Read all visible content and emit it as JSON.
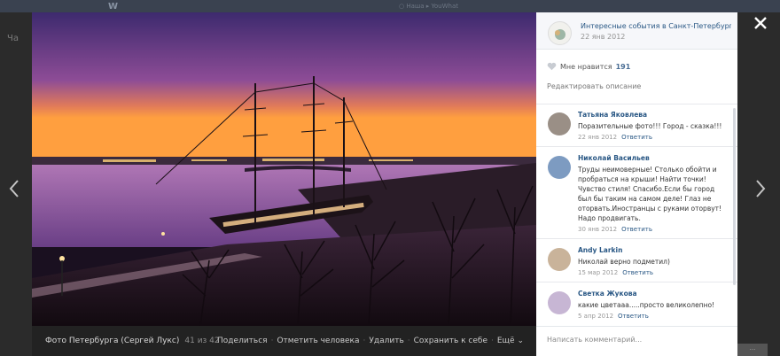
{
  "background": {
    "logo": "W",
    "top_text": "○ Наша ▸ YouWhat",
    "side_text": "Ча"
  },
  "photo": {
    "title": "Фото Петербурга (Сергей Лукс)",
    "counter": "41 из 42",
    "actions": [
      "Поделиться",
      "Отметить человека",
      "Удалить",
      "Сохранить к себе",
      "Ещё"
    ],
    "more_label": "Ещё"
  },
  "album": {
    "title": "Интересные события в Санкт-Петербург...",
    "date": "22 янв 2012"
  },
  "likes": {
    "label": "Мне нравится",
    "count": "191"
  },
  "edit_description": "Редактировать описание",
  "comments": [
    {
      "author": "Татьяна Яковлева",
      "text": "Поразительные фото!!! Город - сказка!!!",
      "date": "22 янв 2012",
      "reply": "Ответить",
      "avatar_color": "#9a8f86"
    },
    {
      "author": "Николай Васильев",
      "text": "Труды неимоверные! Столько обойти и пробраться на крыши! Найти точки! Чувство стиля! Спасибо.Если бы город был бы таким на самом деле! Глаз не оторвать.Иностранцы с руками оторвут! Надо продвигать.",
      "date": "30 янв 2012",
      "reply": "Ответить",
      "avatar_color": "#7d9bc1"
    },
    {
      "author": "Andy Larkin",
      "text": "Николай верно подметил)",
      "date": "15 мар 2012",
      "reply": "Ответить",
      "avatar_color": "#c9b39a"
    },
    {
      "author": "Светка Жукова",
      "text": "какие цветааа.....просто великолепно!",
      "date": "5 апр 2012",
      "reply": "Ответить",
      "avatar_color": "#c7b6d4"
    }
  ],
  "comment_input": {
    "placeholder": "Написать комментарий..."
  },
  "colors": {
    "link": "#2a5885",
    "sky_top": "#4a2f7a",
    "sky_glow": "#ff9a3c",
    "water": "#8a4f9e"
  }
}
